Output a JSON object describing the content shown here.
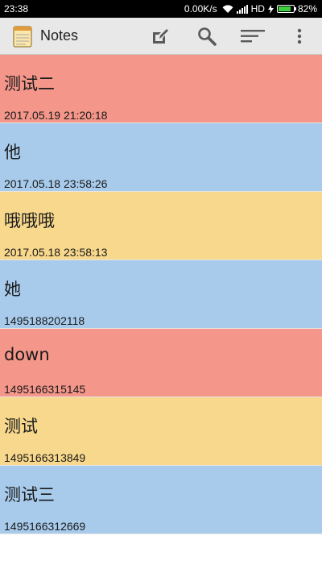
{
  "status_bar": {
    "time": "23:38",
    "net_speed": "0.00K/s",
    "network": "HD",
    "battery": "82%",
    "battery_level": 0.82
  },
  "app_bar": {
    "title": "Notes",
    "actions": [
      "edit-icon",
      "search-icon",
      "sort-icon",
      "overflow-menu-icon"
    ]
  },
  "colors": {
    "red": "#f4968a",
    "blue": "#a8cbec",
    "yellow": "#f8d88c"
  },
  "notes": [
    {
      "title": "测试二",
      "date": "2017.05.19 21:20:18",
      "color": "red"
    },
    {
      "title": "他",
      "date": "2017.05.18 23:58:26",
      "color": "blue"
    },
    {
      "title": "哦哦哦",
      "date": "2017.05.18 23:58:13",
      "color": "yellow"
    },
    {
      "title": "她",
      "date": "1495188202118",
      "color": "blue"
    },
    {
      "title": "down",
      "date": "1495166315145",
      "color": "red"
    },
    {
      "title": "测试",
      "date": "1495166313849",
      "color": "yellow"
    },
    {
      "title": "测试三",
      "date": "1495166312669",
      "color": "blue"
    }
  ]
}
